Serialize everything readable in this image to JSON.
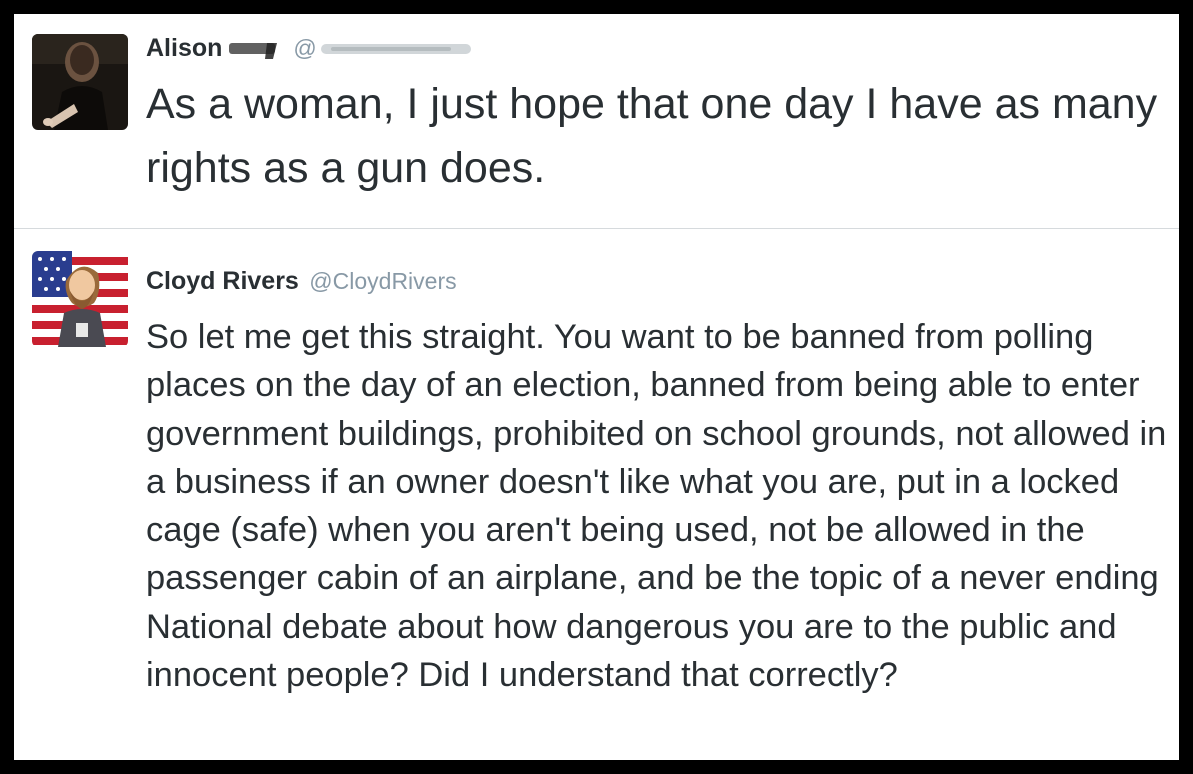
{
  "tweets": [
    {
      "author_name": "Alison",
      "handle_prefix": "@",
      "avatar_icon": "user-photo-avatar",
      "text": "As a woman, I just hope that one day I have as many rights as a gun does."
    },
    {
      "author_name": "Cloyd Rivers",
      "handle": "@CloydRivers",
      "avatar_icon": "cartoon-flag-avatar",
      "text": "So let me get this straight. You want to be banned from polling places on the day of an election, banned from being able to enter government buildings, prohibited on school grounds, not allowed in a business if an owner doesn't like what you are, put in a locked cage (safe) when you aren't being used, not be allowed in the passenger cabin of an airplane, and be the topic of a never ending National debate about how dangerous you are to the public and innocent people? Did I understand that correctly?"
    }
  ],
  "colors": {
    "text": "#292f33",
    "handle": "#8899a6",
    "divider": "#d6dadd",
    "border": "#000000"
  }
}
